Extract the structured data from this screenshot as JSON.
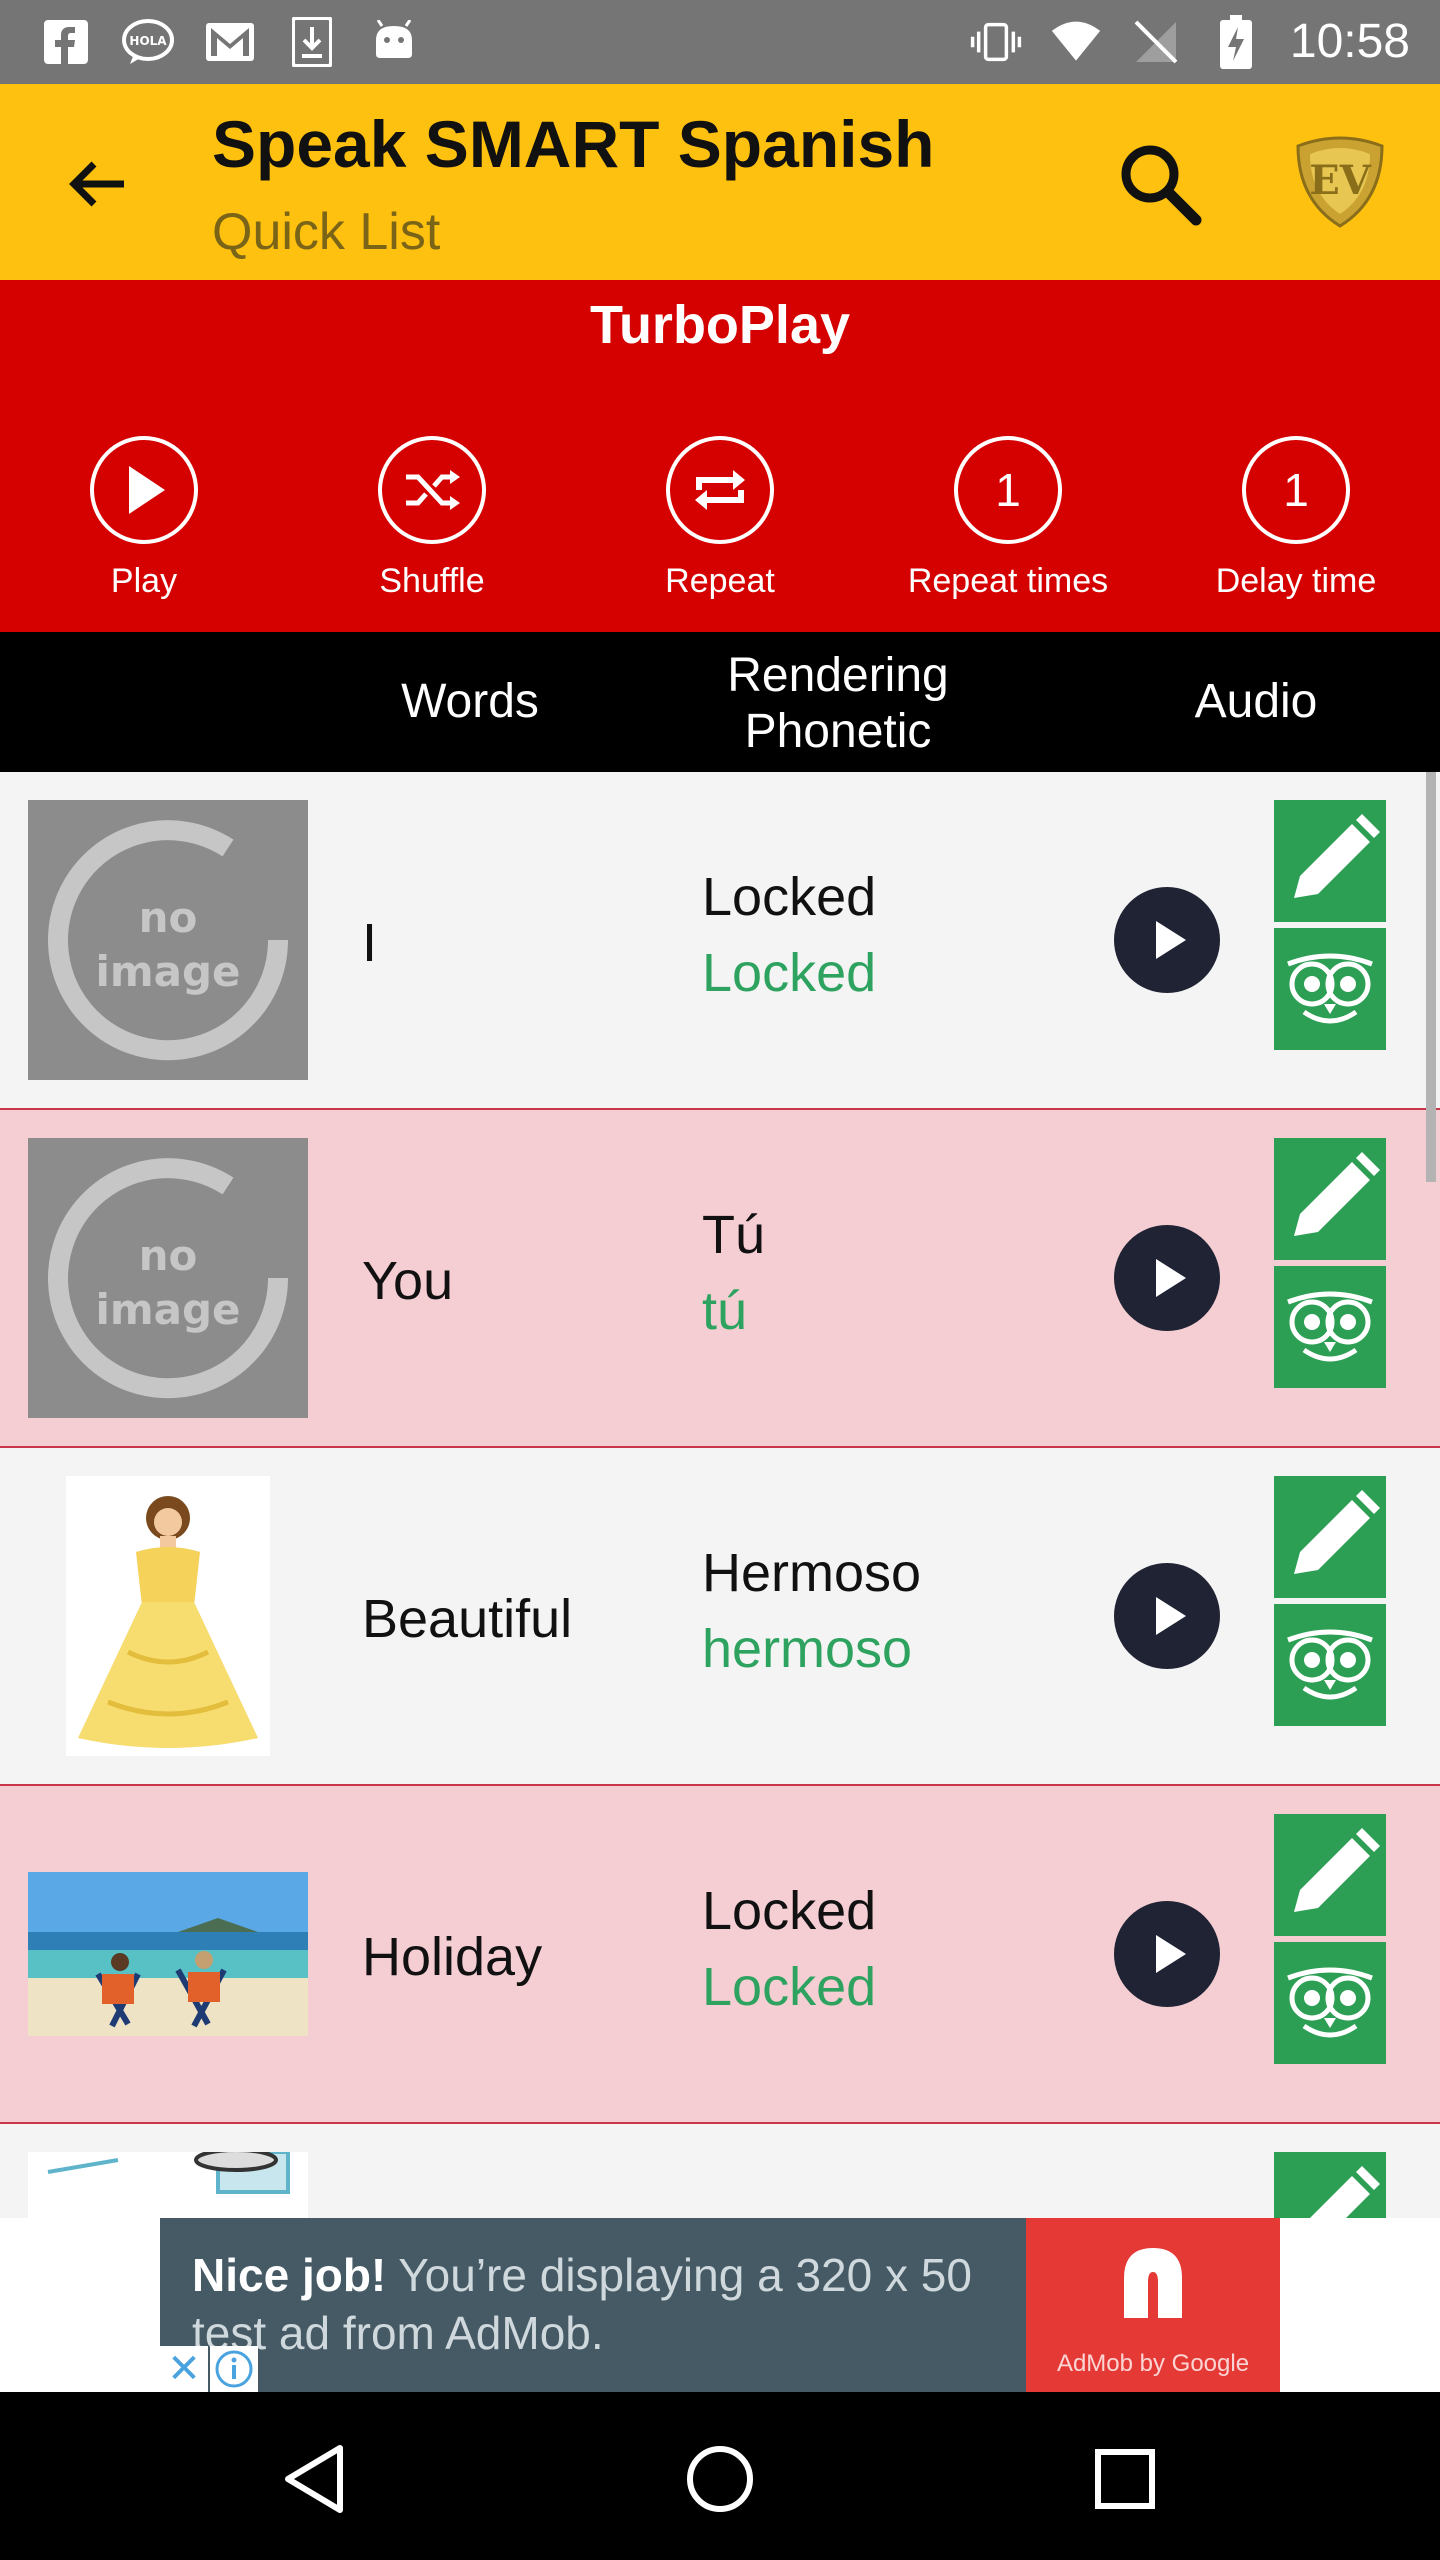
{
  "status_bar": {
    "time": "10:58"
  },
  "app_bar": {
    "title": "Speak SMART Spanish",
    "subtitle": "Quick List"
  },
  "turboplay": {
    "title": "TurboPlay",
    "controls": [
      {
        "label": "Play",
        "icon": "play-icon"
      },
      {
        "label": "Shuffle",
        "icon": "shuffle-icon"
      },
      {
        "label": "Repeat",
        "icon": "repeat-icon"
      },
      {
        "label": "Repeat times",
        "value": "1"
      },
      {
        "label": "Delay time",
        "value": "1"
      }
    ]
  },
  "columns": {
    "words": "Words",
    "rendering": "Rendering",
    "phonetic": "Phonetic",
    "audio": "Audio"
  },
  "rows": [
    {
      "image": "no-image",
      "word": "I",
      "rendering": "Locked",
      "phonetic": "Locked"
    },
    {
      "image": "no-image",
      "word": "You",
      "rendering": "Tú",
      "phonetic": "tú"
    },
    {
      "image": "princess-image",
      "word": "Beautiful",
      "rendering": "Hermoso",
      "phonetic": "hermoso"
    },
    {
      "image": "beach-image",
      "word": "Holiday",
      "rendering": "Locked",
      "phonetic": "Locked"
    }
  ],
  "no_image": {
    "line1": "no",
    "line2": "image"
  },
  "ad": {
    "headline": "Nice job!",
    "body": "You’re displaying a 320 x 50 test ad from AdMob.",
    "brand": "AdMob by Google"
  },
  "colors": {
    "app_bar": "#ffc10f",
    "turboplay": "#d50000",
    "action_green": "#2d9f55",
    "phonetic_green": "#2ea360",
    "row_pink": "#f5ced4"
  }
}
